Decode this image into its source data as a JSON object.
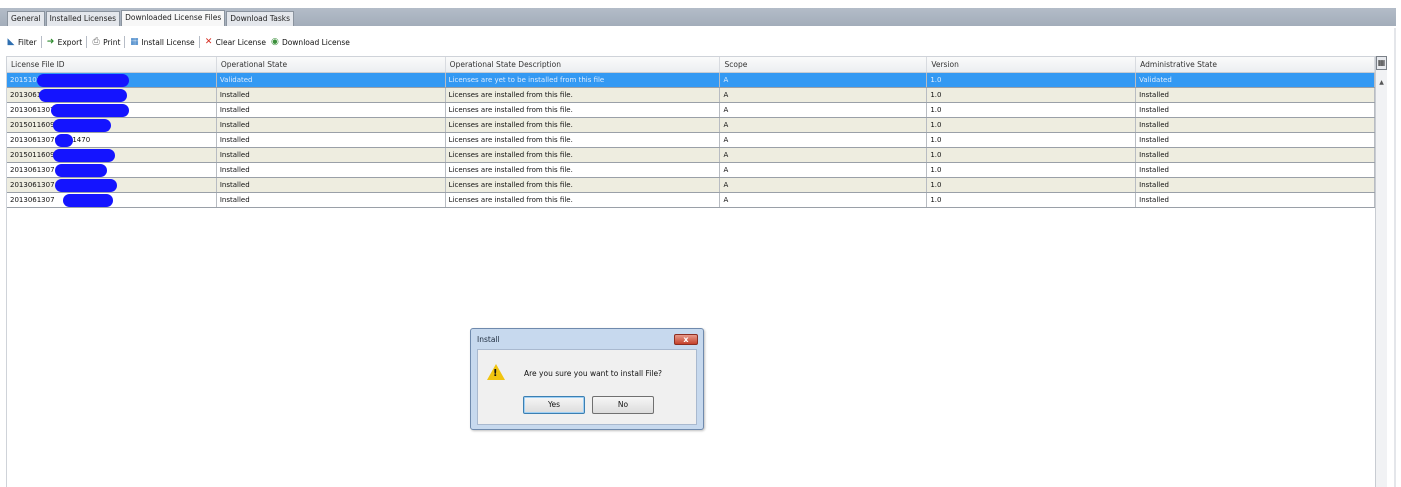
{
  "tabs": [
    {
      "label": "General"
    },
    {
      "label": "Installed Licenses"
    },
    {
      "label": "Downloaded License Files"
    },
    {
      "label": "Download Tasks"
    }
  ],
  "toolbar": {
    "filter": "Filter",
    "export": "Export",
    "print": "Print",
    "install_license": "Install License",
    "clear_license": "Clear License",
    "download_license": "Download License"
  },
  "table": {
    "columns": [
      "License File ID",
      "Operational State",
      "Operational State Description",
      "Scope",
      "Version",
      "Administrative State"
    ],
    "rows": [
      {
        "id": "2015102",
        "op_state": "Validated",
        "desc": "Licenses are yet to be installed from this file",
        "scope": "A",
        "version": "1.0",
        "admin_state": "Validated"
      },
      {
        "id": "2013061",
        "op_state": "Installed",
        "desc": "Licenses are installed from this file.",
        "scope": "A",
        "version": "1.0",
        "admin_state": "Installed"
      },
      {
        "id": "2013061307",
        "op_state": "Installed",
        "desc": "Licenses are installed from this file.",
        "scope": "A",
        "version": "1.0",
        "admin_state": "Installed"
      },
      {
        "id": "2015011609",
        "op_state": "Installed",
        "desc": "Licenses are installed from this file.",
        "scope": "A",
        "version": "1.0",
        "admin_state": "Installed"
      },
      {
        "id": "201306130704101470",
        "op_state": "Installed",
        "desc": "Licenses are installed from this file.",
        "scope": "A",
        "version": "1.0",
        "admin_state": "Installed"
      },
      {
        "id": "2015011609",
        "op_state": "Installed",
        "desc": "Licenses are installed from this file.",
        "scope": "A",
        "version": "1.0",
        "admin_state": "Installed"
      },
      {
        "id": "2013061307",
        "op_state": "Installed",
        "desc": "Licenses are installed from this file.",
        "scope": "A",
        "version": "1.0",
        "admin_state": "Installed"
      },
      {
        "id": "2013061307",
        "op_state": "Installed",
        "desc": "Licenses are installed from this file.",
        "scope": "A",
        "version": "1.0",
        "admin_state": "Installed"
      },
      {
        "id": "2013061307",
        "op_state": "Installed",
        "desc": "Licenses are installed from this file.",
        "scope": "A",
        "version": "1.0",
        "admin_state": "Installed"
      }
    ]
  },
  "dialog": {
    "title": "Install",
    "message": "Are you sure you want to install File?",
    "yes": "Yes",
    "no": "No",
    "close_glyph": "x"
  },
  "colors": {
    "selected_row": "#3399f3",
    "odd_row": "#eeede0",
    "redaction": "#1414ff",
    "dialog_frame": "#c7d9ee"
  }
}
